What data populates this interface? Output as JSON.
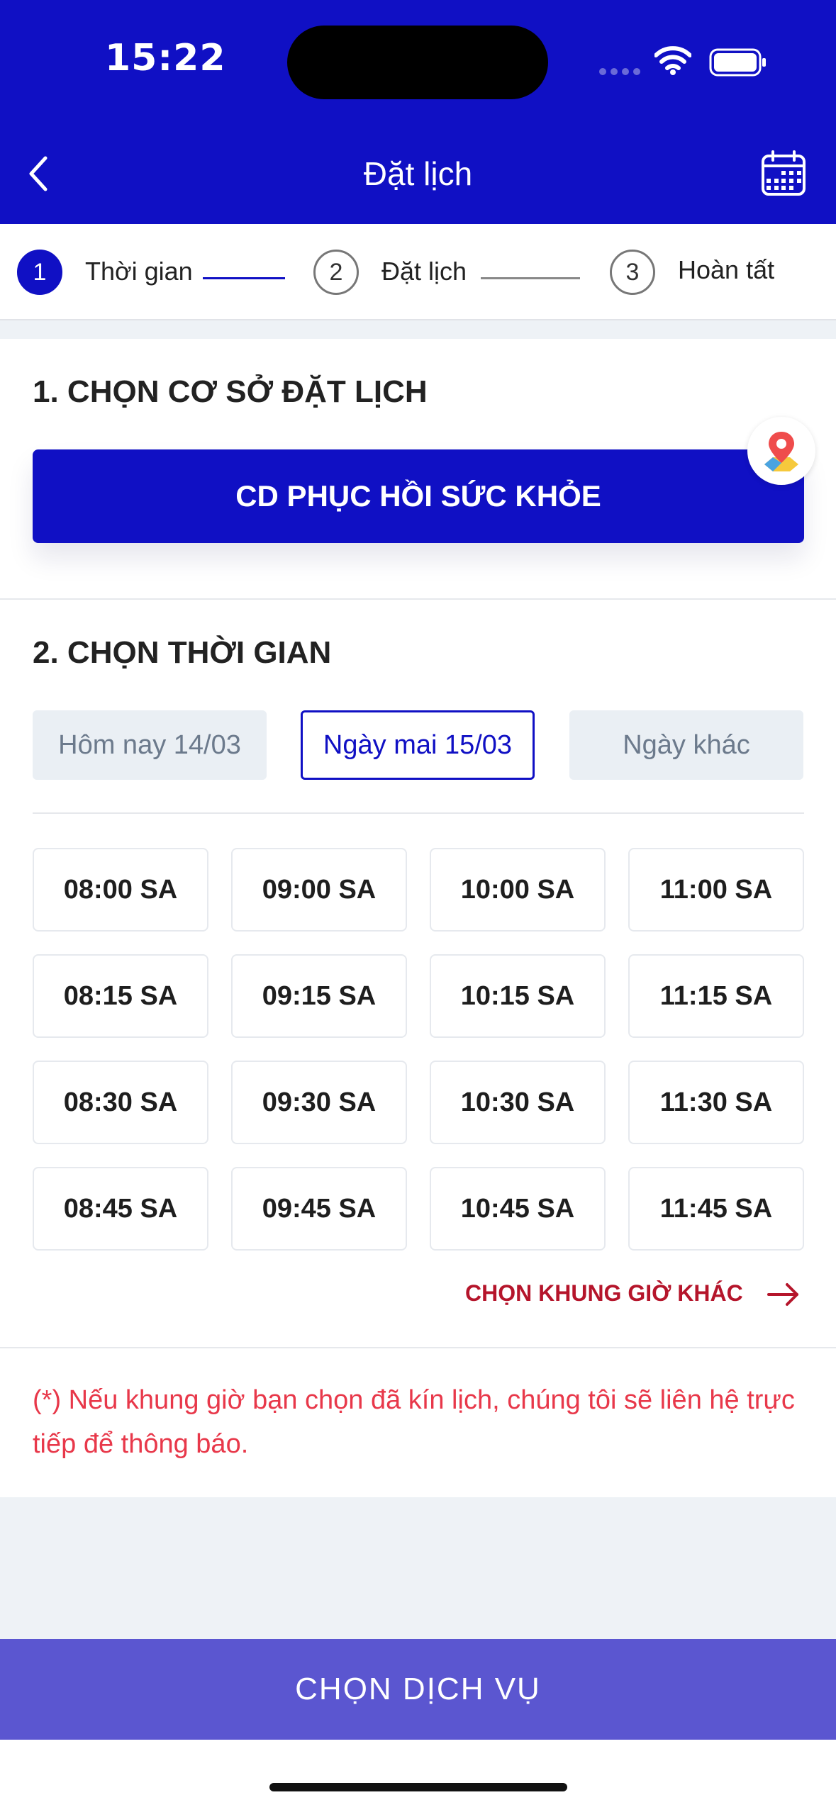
{
  "status_bar": {
    "time": "15:22"
  },
  "header": {
    "title": "Đặt lịch"
  },
  "stepper": [
    {
      "number": "1",
      "label": "Thời gian"
    },
    {
      "number": "2",
      "label": "Đặt lịch"
    },
    {
      "number": "3",
      "label": "Hoàn tất"
    }
  ],
  "facility": {
    "heading": "1. CHỌN CƠ SỞ ĐẶT LỊCH",
    "button_label": "CD PHỤC HỒI SỨC KHỎE"
  },
  "time_section": {
    "heading": "2. CHỌN THỜI GIAN",
    "date_tabs": [
      "Hôm nay 14/03",
      "Ngày mai 15/03",
      "Ngày khác"
    ],
    "selected_date_index": 1,
    "slots": [
      [
        "08:00 SA",
        "09:00 SA",
        "10:00 SA",
        "11:00 SA"
      ],
      [
        "08:15 SA",
        "09:15 SA",
        "10:15 SA",
        "11:15 SA"
      ],
      [
        "08:30 SA",
        "09:30 SA",
        "10:30 SA",
        "11:30 SA"
      ],
      [
        "08:45 SA",
        "09:45 SA",
        "10:45 SA",
        "11:45 SA"
      ]
    ],
    "other_times_label": "CHỌN KHUNG GIỜ KHÁC"
  },
  "note": "(*) Nếu khung giờ bạn chọn đã kín lịch, chúng tôi sẽ liên hệ trực tiếp để thông báo.",
  "cta": {
    "label": "CHỌN DỊCH VỤ"
  },
  "colors": {
    "primary": "#1010c4",
    "cta": "#5b56d0",
    "link_red": "#b5152b",
    "note_red": "#e8384a"
  }
}
